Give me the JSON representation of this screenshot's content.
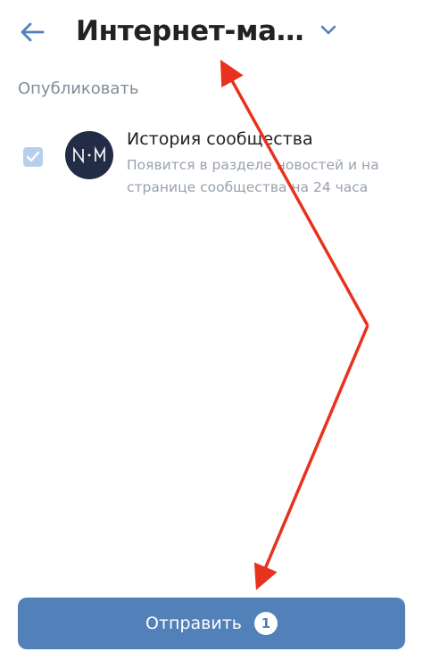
{
  "header": {
    "title": "Интернет-маркетинг",
    "back_icon": "arrow-left-icon",
    "dropdown_icon": "chevron-down-icon"
  },
  "section": {
    "label": "Опубликовать"
  },
  "option": {
    "checked": true,
    "avatar_text": "И·М",
    "title": "История сообщества",
    "description": "Появится в разделе новостей и на странице сообщества на 24 часа"
  },
  "send_button": {
    "label": "Отправить",
    "badge": "1"
  },
  "colors": {
    "accent": "#5181b8",
    "checkbox": "#b7cfec",
    "avatar_bg": "#222c47",
    "annotation": "#e8321e"
  }
}
